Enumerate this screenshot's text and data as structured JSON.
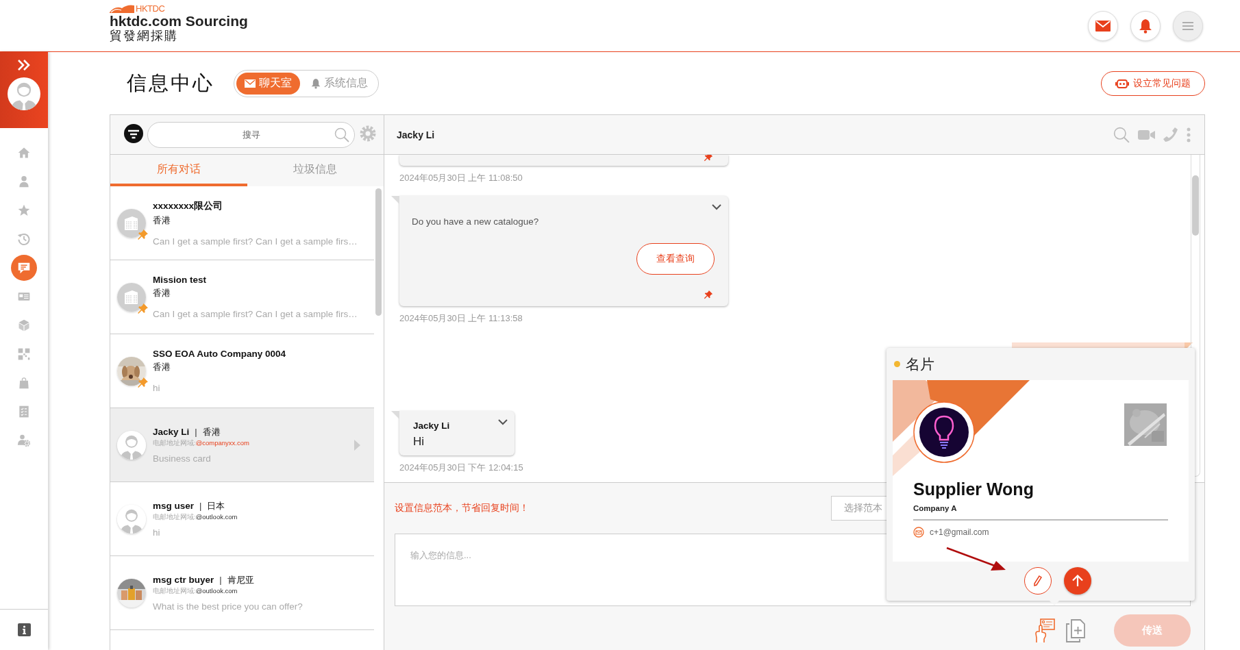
{
  "header": {
    "logo_mark": "HKTDC",
    "logo_title": "hktdc.com Sourcing",
    "logo_subtitle": "貿發網採購"
  },
  "sidebar": {
    "items": [
      {
        "kind": "home",
        "selected": false
      },
      {
        "kind": "user",
        "selected": false
      },
      {
        "kind": "star",
        "selected": false
      },
      {
        "kind": "history",
        "selected": false
      },
      {
        "kind": "chat",
        "selected": true
      },
      {
        "kind": "card",
        "selected": false
      },
      {
        "kind": "cube",
        "selected": false
      },
      {
        "kind": "grid",
        "selected": false
      },
      {
        "kind": "bag",
        "selected": false
      },
      {
        "kind": "checklist",
        "selected": false
      },
      {
        "kind": "user-gear",
        "selected": false
      }
    ]
  },
  "page": {
    "title": "信息中心",
    "mode_tabs": [
      {
        "label": "聊天室",
        "kind": "mail",
        "selected": true
      },
      {
        "label": "系统信息",
        "kind": "bell",
        "selected": false
      }
    ],
    "faq_button": "设立常见问题"
  },
  "conversations": {
    "search": {
      "placeholder": "搜寻"
    },
    "tabs": [
      {
        "label": "所有对话",
        "selected": true
      },
      {
        "label": "垃圾信息",
        "selected": false
      }
    ],
    "items": [
      {
        "kind": "company",
        "avatar": {
          "kind": "building"
        },
        "pinned": true,
        "selected": false,
        "name": "xxxxxxxx限公司",
        "location": "香港",
        "preview": "Can I get a sample first? Can I get a sample firs…"
      },
      {
        "kind": "company",
        "avatar": {
          "kind": "building"
        },
        "pinned": true,
        "selected": false,
        "name": "Mission test",
        "location": "香港",
        "preview": "Can I get a sample first? Can I get a sample firs…"
      },
      {
        "kind": "company",
        "pinned": true,
        "selected": false,
        "name": "SSO EOA Auto Company 0004",
        "location": "香港",
        "preview": "hi"
      },
      {
        "kind": "user",
        "avatar": {
          "kind": "person"
        },
        "pinned": false,
        "selected": true,
        "name": "Jacky Li",
        "separator": "|",
        "location": "香港",
        "email_label": "电邮地址网域:",
        "email_domain": "@companyxx.com",
        "domain_highlighted": true,
        "preview": "Business card"
      },
      {
        "kind": "user",
        "avatar": {
          "kind": "person"
        },
        "pinned": false,
        "selected": false,
        "name": "msg user",
        "separator": "|",
        "location": "日本",
        "email_label": "电邮地址网域:",
        "email_domain": "@outlook.com",
        "domain_highlighted": false,
        "preview": "hi"
      },
      {
        "kind": "user",
        "pinned": false,
        "selected": false,
        "name": "msg ctr buyer",
        "separator": "|",
        "location": "肯尼亚",
        "email_label": "电邮地址网域:",
        "email_domain": "@outlook.com",
        "domain_highlighted": false,
        "preview": "What is the best price you can offer?"
      }
    ]
  },
  "chat": {
    "contact": "Jacky Li",
    "messages": [
      {
        "kind": "tail",
        "pinned": true,
        "time": "2024年05月30日 上午 11:08:50"
      },
      {
        "kind": "inquiry",
        "pinned": true,
        "text": "Do you have a new catalogue?",
        "action": "查看查询",
        "time": "2024年05月30日 上午 11:13:58"
      },
      {
        "kind": "outgoing"
      },
      {
        "kind": "text",
        "sender": "Jacky Li",
        "text": "Hi",
        "time": "2024年05月30日 下午 12:04:15"
      }
    ]
  },
  "composer": {
    "template_hint": "设置信息范本，节省回复时间！",
    "template_button": "选择范本",
    "placeholder": "输入您的信息...",
    "send": "传送",
    "send_disabled": true
  },
  "business_card": {
    "title": "名片",
    "name": "Supplier Wong",
    "company": "Company A",
    "email": "c+1@gmail.com"
  }
}
